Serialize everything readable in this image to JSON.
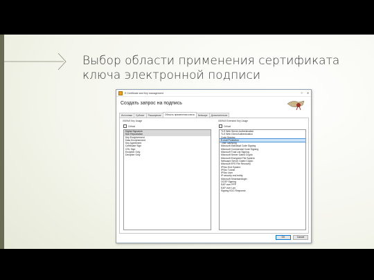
{
  "slide": {
    "title_line1": "Выбор области применения сертификата",
    "title_line2": "ключа электронной подписи"
  },
  "dialog": {
    "window_title": "E Certificate and Key management",
    "header_title": "Создать запрос на подпись",
    "tabs": [
      {
        "label": "Источники"
      },
      {
        "label": "Субъект"
      },
      {
        "label": "Расширение"
      },
      {
        "label": "Область применения ключа"
      },
      {
        "label": "Netscape"
      },
      {
        "label": "Дополнительно"
      }
    ],
    "active_tab": "Область применения ключа",
    "key_usage": {
      "group_label": "X509v3 Key Usage",
      "critical_label": "Critical",
      "critical_checked": false,
      "items": [
        "Digital Signature",
        "Non Repudiation",
        "Key Encipherment",
        "Data Encipherment",
        "Key Agreement",
        "Certificate Sign",
        "CRL Sign",
        "Encipher Only",
        "Decipher Only"
      ],
      "selected": [
        "Digital Signature",
        "Non Repudiation"
      ]
    },
    "extended_key_usage": {
      "group_label": "X509v3 Extended Key Usage",
      "critical_label": "Critical",
      "critical_checked": false,
      "items": [
        "TLS Web Server Authentication",
        "TLS Web Client Authentication",
        "Code Signing",
        "E-mail Protection",
        "Time Stamping",
        "Microsoft Individual Code Signing",
        "Microsoft Commercial Code Signing",
        "Microsoft Trust List Signing",
        "Microsoft Server Gated Crypto",
        "Microsoft Encrypted File System",
        "Netscape Server Gated Crypto",
        "Microsoft EFS File Recovery",
        "IPSec End System",
        "IPSec Tunnel",
        "IPSec User",
        "IP security end entity",
        "Microsoft Smartcardlogin",
        "OCSP Signing",
        "EAP over PPP",
        "EAP over Lan",
        "Signing KDC Response"
      ],
      "selected": [
        "E-mail Protection"
      ]
    },
    "buttons": {
      "ok": "OK",
      "cancel": "Cancel"
    }
  },
  "colors": {
    "selection_grey": "#d9d9d9",
    "selection_blue": "#cce4f7",
    "window_border": "#8ea1b5"
  }
}
